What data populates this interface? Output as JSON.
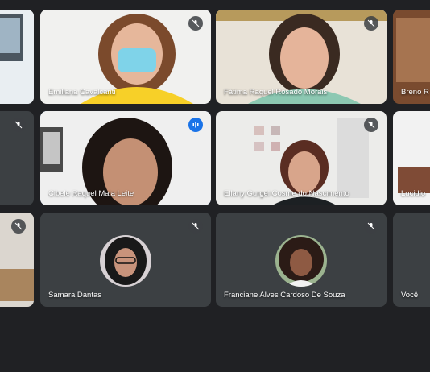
{
  "meeting": {
    "bg_color": "#202124",
    "tile_color": "#3c4043",
    "accent_color": "#8ab4f8",
    "speaking_color": "#1a73e8"
  },
  "participants": [
    {
      "name": "",
      "mic": "none"
    },
    {
      "name": "Emiliana Cavalcanti",
      "mic": "muted"
    },
    {
      "name": "Fátima Raquel Rosado Morais",
      "mic": "muted"
    },
    {
      "name": "Breno R",
      "mic": "none"
    },
    {
      "name": "",
      "mic": "muted"
    },
    {
      "name": "Cibele Raquel Maia Leite",
      "mic": "speaking"
    },
    {
      "name": "Ellany Gurgel Cosme do Nascimento",
      "mic": "muted"
    },
    {
      "name": "Lucidio",
      "mic": "none"
    },
    {
      "name": "",
      "mic": "muted"
    },
    {
      "name": "Samara Dantas",
      "mic": "muted"
    },
    {
      "name": "Franciane Alves Cardoso De Souza",
      "mic": "muted"
    },
    {
      "name": "Você",
      "mic": "none"
    }
  ]
}
